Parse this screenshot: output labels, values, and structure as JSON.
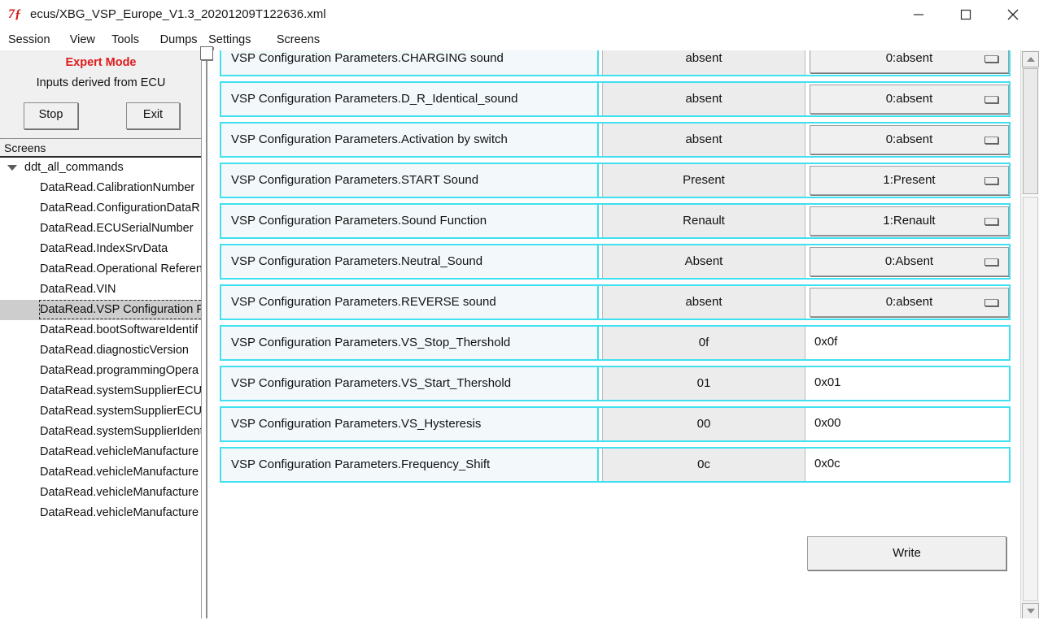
{
  "window": {
    "title": "ecus/XBG_VSP_Europe_V1.3_20201209T122636.xml",
    "app_icon": "7ƒ",
    "minimize_icon": "minimize-icon",
    "maximize_icon": "maximize-icon",
    "close_icon": "close-icon"
  },
  "menubar": {
    "items": [
      {
        "label": "Session"
      },
      {
        "label": "View"
      },
      {
        "label": "Tools"
      },
      {
        "label": "Dumps"
      },
      {
        "label": "Settings"
      },
      {
        "label": "Screens"
      }
    ]
  },
  "sidebar": {
    "mode_banner": "Expert Mode",
    "inputs_note": "Inputs derived from ECU",
    "stop_button": "Stop",
    "exit_button": "Exit",
    "screens_header": "Screens",
    "tree_root": "ddt_all_commands",
    "tree_items": [
      {
        "label": "DataRead.CalibrationNumber",
        "selected": false
      },
      {
        "label": "DataRead.ConfigurationDataR",
        "selected": false
      },
      {
        "label": "DataRead.ECUSerialNumber",
        "selected": false
      },
      {
        "label": "DataRead.IndexSrvData",
        "selected": false
      },
      {
        "label": "DataRead.Operational Referen",
        "selected": false
      },
      {
        "label": "DataRead.VIN",
        "selected": false
      },
      {
        "label": "DataRead.VSP Configuration P",
        "selected": true
      },
      {
        "label": "DataRead.bootSoftwareIdentif",
        "selected": false
      },
      {
        "label": "DataRead.diagnosticVersion",
        "selected": false
      },
      {
        "label": "DataRead.programmingOpera",
        "selected": false
      },
      {
        "label": "DataRead.systemSupplierECUS",
        "selected": false
      },
      {
        "label": "DataRead.systemSupplierECUS",
        "selected": false
      },
      {
        "label": "DataRead.systemSupplierIdent",
        "selected": false
      },
      {
        "label": "DataRead.vehicleManufacture",
        "selected": false
      },
      {
        "label": "DataRead.vehicleManufacture",
        "selected": false
      },
      {
        "label": "DataRead.vehicleManufacture",
        "selected": false
      },
      {
        "label": "DataRead.vehicleManufacture",
        "selected": false
      }
    ]
  },
  "main": {
    "rows": [
      {
        "label": "VSP Configuration Parameters.CHARGING sound",
        "value": "absent",
        "control_type": "combo",
        "control_value": "0:absent"
      },
      {
        "label": "VSP Configuration Parameters.D_R_Identical_sound",
        "value": "absent",
        "control_type": "combo",
        "control_value": "0:absent"
      },
      {
        "label": "VSP Configuration Parameters.Activation by switch",
        "value": "absent",
        "control_type": "combo",
        "control_value": "0:absent"
      },
      {
        "label": "VSP Configuration Parameters.START Sound",
        "value": "Present",
        "control_type": "combo",
        "control_value": "1:Present"
      },
      {
        "label": "VSP Configuration Parameters.Sound Function",
        "value": "Renault",
        "control_type": "combo",
        "control_value": "1:Renault"
      },
      {
        "label": "VSP Configuration Parameters.Neutral_Sound",
        "value": "Absent",
        "control_type": "combo",
        "control_value": "0:Absent"
      },
      {
        "label": "VSP Configuration Parameters.REVERSE sound",
        "value": "absent",
        "control_type": "combo",
        "control_value": "0:absent"
      },
      {
        "label": "VSP Configuration Parameters.VS_Stop_Thershold",
        "value": "0f",
        "control_type": "text",
        "control_value": "0x0f"
      },
      {
        "label": "VSP Configuration Parameters.VS_Start_Thershold",
        "value": "01",
        "control_type": "text",
        "control_value": "0x01"
      },
      {
        "label": "VSP Configuration Parameters.VS_Hysteresis",
        "value": "00",
        "control_type": "text",
        "control_value": "0x00"
      },
      {
        "label": "VSP Configuration Parameters.Frequency_Shift",
        "value": "0c",
        "control_type": "text",
        "control_value": "0x0c"
      }
    ],
    "write_button": "Write"
  },
  "colors": {
    "accent_cyan": "#3fe0ef",
    "expert_mode_red": "#e01b1b",
    "label_bg": "#f3f8fb",
    "value_bg": "#ececec",
    "panel_bg": "#f0f0f0"
  }
}
